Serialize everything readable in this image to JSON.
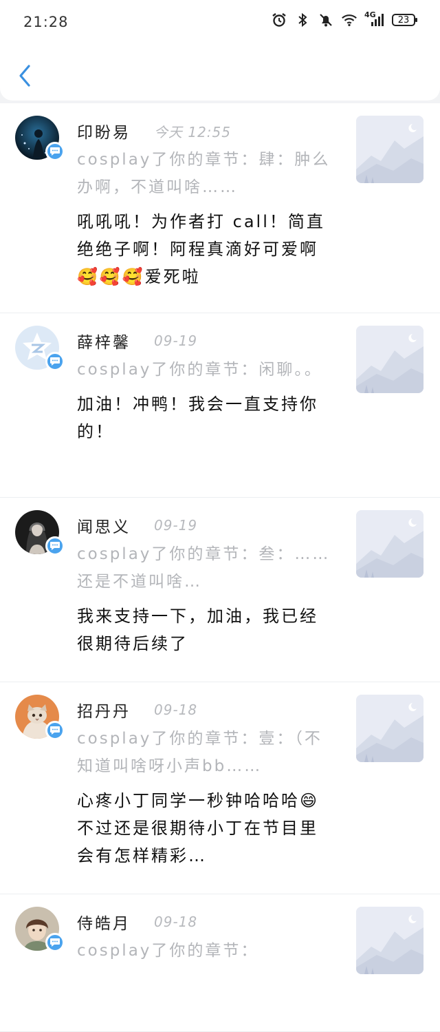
{
  "status_bar": {
    "time": "21:28",
    "network": "4G",
    "battery": "23",
    "icons": [
      "alarm-icon",
      "bluetooth-icon",
      "mute-icon",
      "wifi-icon",
      "signal-icon",
      "battery-icon"
    ]
  },
  "header": {
    "back_icon": "chevron-left-icon"
  },
  "colors": {
    "accent": "#4aa3ee",
    "muted_text": "#b3b5b9",
    "page_bg": "#f2f3f5"
  },
  "notifications": [
    {
      "name": "印盼易",
      "time": "今天 12:55",
      "chapter": "cosplay了你的章节：肆：肿么办啊，不道叫啥……",
      "comment": "吼吼吼！为作者打 call！简直绝绝子啊！阿程真滴好可爱啊🥰🥰🥰爱死啦"
    },
    {
      "name": "薛梓馨",
      "time": "09-19",
      "chapter": "cosplay了你的章节：闲聊。。",
      "comment": "加油！冲鸭！我会一直支持你的！"
    },
    {
      "name": "闻思义",
      "time": "09-19",
      "chapter": "cosplay了你的章节：叁：……还是不道叫啥…",
      "comment": "我来支持一下，加油，我已经很期待后续了"
    },
    {
      "name": "招丹丹",
      "time": "09-18",
      "chapter": "cosplay了你的章节：壹：（不知道叫啥呀小声bb……",
      "comment": "心疼小丁同学一秒钟哈哈哈😄不过还是很期待小丁在节目里会有怎样精彩…"
    },
    {
      "name": "侍皓月",
      "time": "09-18",
      "chapter": "cosplay了你的章节：",
      "comment": ""
    }
  ]
}
